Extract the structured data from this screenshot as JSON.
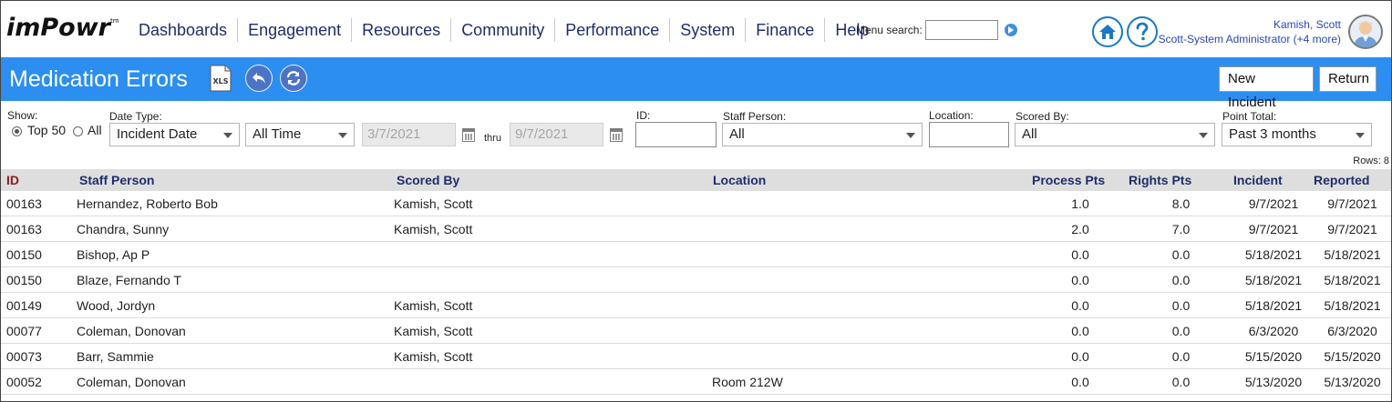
{
  "app": {
    "logo": "imPowr",
    "logo_tm": "tm",
    "nav": [
      "Dashboards",
      "Engagement",
      "Resources",
      "Community",
      "Performance",
      "System",
      "Finance",
      "Help"
    ],
    "menu_search_label": "Menu search:",
    "menu_search_value": "",
    "user_name": "Kamish, Scott",
    "user_role": "Scott-System Administrator (+4 more)",
    "icons": {
      "home": "home-icon",
      "help": "help-icon",
      "go": "go-arrow-icon",
      "avatar": "user-avatar"
    },
    "accent_color": "#2b8ef0"
  },
  "page": {
    "title": "Medication Errors",
    "xls_label": "XLS",
    "buttons": {
      "new_incident": "New Incident",
      "return": "Return"
    }
  },
  "filters": {
    "show_label": "Show:",
    "show_options": [
      "Top 50",
      "All"
    ],
    "show_selected": "Top 50",
    "date_type_label": "Date Type:",
    "date_type_value": "Incident Date",
    "period_value": "All Time",
    "date_from": "3/7/2021",
    "thru_label": "thru",
    "date_to": "9/7/2021",
    "id_label": "ID:",
    "id_value": "",
    "staff_label": "Staff Person:",
    "staff_value": "All",
    "location_label": "Location:",
    "location_value": "",
    "scored_by_label": "Scored By:",
    "scored_by_value": "All",
    "point_total_label": "Point Total:",
    "point_total_value": "Past 3 months"
  },
  "table": {
    "rows_label": "Rows: 8",
    "columns": [
      "ID",
      "Staff Person",
      "Scored By",
      "Location",
      "Process Pts",
      "Rights Pts",
      "Incident",
      "Reported"
    ],
    "rows": [
      {
        "id": "00163",
        "staff": "Hernandez, Roberto Bob",
        "scored_by": "Kamish, Scott",
        "location": "",
        "process": "1.0",
        "rights": "8.0",
        "incident": "9/7/2021",
        "reported": "9/7/2021"
      },
      {
        "id": "00163",
        "staff": "Chandra, Sunny",
        "scored_by": "Kamish, Scott",
        "location": "",
        "process": "2.0",
        "rights": "7.0",
        "incident": "9/7/2021",
        "reported": "9/7/2021"
      },
      {
        "id": "00150",
        "staff": "Bishop, Ap P",
        "scored_by": "",
        "location": "",
        "process": "0.0",
        "rights": "0.0",
        "incident": "5/18/2021",
        "reported": "5/18/2021"
      },
      {
        "id": "00150",
        "staff": "Blaze, Fernando T",
        "scored_by": "",
        "location": "",
        "process": "0.0",
        "rights": "0.0",
        "incident": "5/18/2021",
        "reported": "5/18/2021"
      },
      {
        "id": "00149",
        "staff": "Wood, Jordyn",
        "scored_by": "Kamish, Scott",
        "location": "",
        "process": "0.0",
        "rights": "0.0",
        "incident": "5/18/2021",
        "reported": "5/18/2021"
      },
      {
        "id": "00077",
        "staff": "Coleman, Donovan",
        "scored_by": "Kamish, Scott",
        "location": "",
        "process": "0.0",
        "rights": "0.0",
        "incident": "6/3/2020",
        "reported": "6/3/2020"
      },
      {
        "id": "00073",
        "staff": "Barr, Sammie",
        "scored_by": "Kamish, Scott",
        "location": "",
        "process": "0.0",
        "rights": "0.0",
        "incident": "5/15/2020",
        "reported": "5/15/2020"
      },
      {
        "id": "00052",
        "staff": "Coleman, Donovan",
        "scored_by": "",
        "location": "Room 212W",
        "process": "0.0",
        "rights": "0.0",
        "incident": "5/13/2020",
        "reported": "5/13/2020"
      }
    ]
  }
}
